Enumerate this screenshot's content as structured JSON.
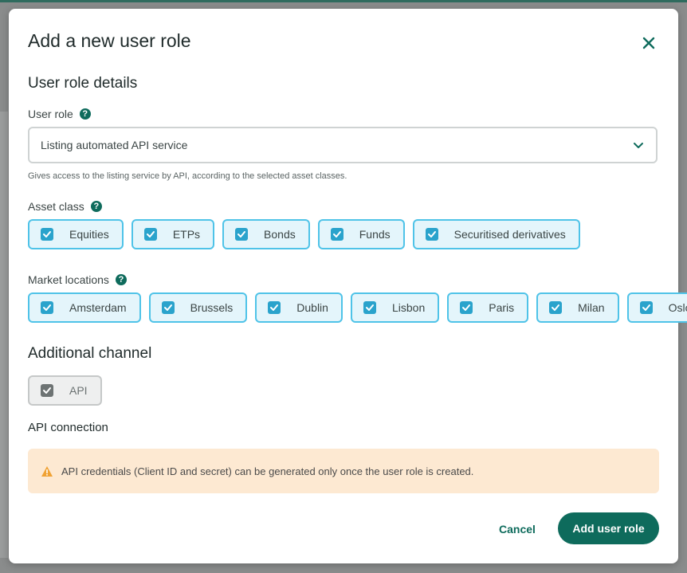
{
  "modal": {
    "title": "Add a new user role",
    "section_title": "User role details"
  },
  "user_role": {
    "label": "User role",
    "selected": "Listing automated API service",
    "hint": "Gives access to the listing service by API, according to the selected asset classes."
  },
  "asset_class": {
    "label": "Asset class",
    "options": [
      {
        "label": "Equities",
        "checked": true
      },
      {
        "label": "ETPs",
        "checked": true
      },
      {
        "label": "Bonds",
        "checked": true
      },
      {
        "label": "Funds",
        "checked": true
      },
      {
        "label": "Securitised derivatives",
        "checked": true
      }
    ]
  },
  "market_locations": {
    "label": "Market locations",
    "options": [
      {
        "label": "Amsterdam",
        "checked": true
      },
      {
        "label": "Brussels",
        "checked": true
      },
      {
        "label": "Dublin",
        "checked": true
      },
      {
        "label": "Lisbon",
        "checked": true
      },
      {
        "label": "Paris",
        "checked": true
      },
      {
        "label": "Milan",
        "checked": true
      },
      {
        "label": "Oslo",
        "checked": true
      }
    ]
  },
  "additional_channel": {
    "title": "Additional channel",
    "options": [
      {
        "label": "API",
        "checked": true,
        "disabled": true
      }
    ]
  },
  "api_connection": {
    "title": "API connection",
    "alert": "API credentials (Client ID and secret) can be generated only once the user role is created."
  },
  "actions": {
    "cancel": "Cancel",
    "submit": "Add user role"
  },
  "colors": {
    "primary": "#0e6b5c",
    "chip_border": "#4fc3e8",
    "chip_bg": "#e4f5fb",
    "alert_bg": "#fde9d2",
    "warning": "#f0a234"
  }
}
